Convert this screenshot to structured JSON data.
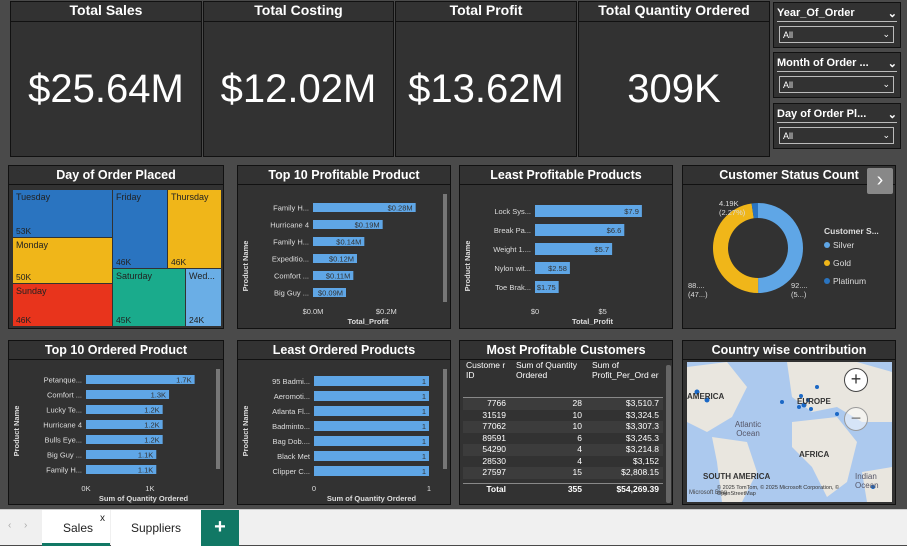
{
  "kpis": [
    {
      "title": "Total Sales",
      "value": "$25.64M"
    },
    {
      "title": "Total Costing",
      "value": "$12.02M"
    },
    {
      "title": "Total Profit",
      "value": "$13.62M"
    },
    {
      "title": "Total Quantity Ordered",
      "value": "309K"
    }
  ],
  "slicers": [
    {
      "title": "Year_Of_Order",
      "value": "All"
    },
    {
      "title": "Month of Order ...",
      "value": "All"
    },
    {
      "title": "Day of Order Pl...",
      "value": "All"
    }
  ],
  "treemap": {
    "title": "Day of Order Placed",
    "cells": [
      {
        "label": "Tuesday",
        "value": "53K",
        "color": "#2a74c0"
      },
      {
        "label": "Monday",
        "value": "50K",
        "color": "#f0b619"
      },
      {
        "label": "Sunday",
        "value": "46K",
        "color": "#e8341c"
      },
      {
        "label": "Friday",
        "value": "46K",
        "color": "#2a74c0"
      },
      {
        "label": "Thursday",
        "value": "46K",
        "color": "#f0b619"
      },
      {
        "label": "Saturday",
        "value": "45K",
        "color": "#1aab8c"
      },
      {
        "label": "Wed...",
        "value": "24K",
        "color": "#6aaee6"
      }
    ]
  },
  "chart_data": [
    {
      "type": "bar",
      "title": "Top 10 Profitable Product",
      "xlabel": "Total_Profit",
      "ylabel": "Product Name",
      "categories": [
        "Family H...",
        "Hurricane 4",
        "Family H...",
        "Expeditio...",
        "Comfort ...",
        "Big Guy ..."
      ],
      "values": [
        0.28,
        0.19,
        0.14,
        0.12,
        0.11,
        0.09
      ],
      "labels": [
        "$0.28M",
        "$0.19M",
        "$0.14M",
        "$0.12M",
        "$0.11M",
        "$0.09M"
      ],
      "ticks": [
        "$0.0M",
        "$0.2M"
      ],
      "xlim": [
        0,
        0.3
      ]
    },
    {
      "type": "bar",
      "title": "Least Profitable Products",
      "xlabel": "Total_Profit",
      "ylabel": "Product Name",
      "categories": [
        "Lock Sys...",
        "Break Pa...",
        "Weight 1....",
        "Nylon wit...",
        "Toe Brak..."
      ],
      "values": [
        7.9,
        6.6,
        5.7,
        2.58,
        1.75
      ],
      "labels": [
        "$7.9",
        "$6.6",
        "$5.7",
        "$2.58",
        "$1.75"
      ],
      "ticks": [
        "$0",
        "$5"
      ],
      "xlim": [
        0,
        8.5
      ]
    },
    {
      "type": "bar",
      "title": "Top 10 Ordered Product",
      "xlabel": "Sum of Quantity Ordered",
      "ylabel": "Product Name",
      "categories": [
        "Petanque...",
        "Comfort ...",
        "Lucky Te...",
        "Hurricane 4",
        "Bulls Eye...",
        "Big Guy ...",
        "Family H..."
      ],
      "values": [
        1.7,
        1.3,
        1.2,
        1.2,
        1.2,
        1.1,
        1.1
      ],
      "labels": [
        "1.7K",
        "1.3K",
        "1.2K",
        "1.2K",
        "1.2K",
        "1.1K",
        "1.1K"
      ],
      "ticks": [
        "0K",
        "1K"
      ],
      "xlim": [
        0,
        1.8
      ]
    },
    {
      "type": "bar",
      "title": "Least Ordered Products",
      "xlabel": "Sum of Quantity Ordered",
      "ylabel": "Product Name",
      "categories": [
        "95 Badmi...",
        "Aeromoti...",
        "Atlanta Fl...",
        "Badminto...",
        "Bag Dob....",
        "Black Met",
        "Clipper C..."
      ],
      "values": [
        1,
        1,
        1,
        1,
        1,
        1,
        1
      ],
      "labels": [
        "1",
        "1",
        "1",
        "1",
        "1",
        "1",
        "1"
      ],
      "ticks": [
        "0",
        "1"
      ],
      "xlim": [
        0,
        1
      ]
    },
    {
      "type": "pie",
      "title": "Customer Status Count",
      "legend_title": "Customer S...",
      "categories": [
        "Silver",
        "Gold",
        "Platinum"
      ],
      "colors": [
        "#5fa6e6",
        "#f0b619",
        "#2a74c0"
      ],
      "values": [
        92,
        88,
        4.19
      ],
      "labels": [
        "92....\n(5...)",
        "88....\n(47...)",
        "4.19K\n(2.27%)"
      ]
    }
  ],
  "table": {
    "title": "Most Profitable Customers",
    "headers": [
      "Custome r ID",
      "Sum of Quantity Ordered",
      "Sum of Profit_Per_Ord er"
    ],
    "rows": [
      [
        "7766",
        "28",
        "$3,510.7"
      ],
      [
        "31519",
        "10",
        "$3,324.5"
      ],
      [
        "77062",
        "10",
        "$3,307.3"
      ],
      [
        "89591",
        "6",
        "$3,245.3"
      ],
      [
        "54290",
        "4",
        "$3,214.8"
      ],
      [
        "28530",
        "4",
        "$3,152"
      ],
      [
        "27597",
        "15",
        "$2,808.15"
      ]
    ],
    "total": [
      "Total",
      "355",
      "$54,269.39"
    ]
  },
  "map": {
    "title": "Country wise contribution",
    "labels": {
      "america": "AMERICA",
      "europe": "EUROPE",
      "africa": "AFRICA",
      "atlantic": "Atlantic Ocean",
      "south": "SOUTH AMERICA",
      "indian": "Indian Ocean"
    },
    "copyright": "© 2025 TomTom, © 2025 Microsoft Corporation, © OpenStreetMap",
    "bing": "Microsoft Bing"
  },
  "tabs": {
    "sales": "Sales",
    "suppliers": "Suppliers",
    "close": "x",
    "add": "+"
  }
}
